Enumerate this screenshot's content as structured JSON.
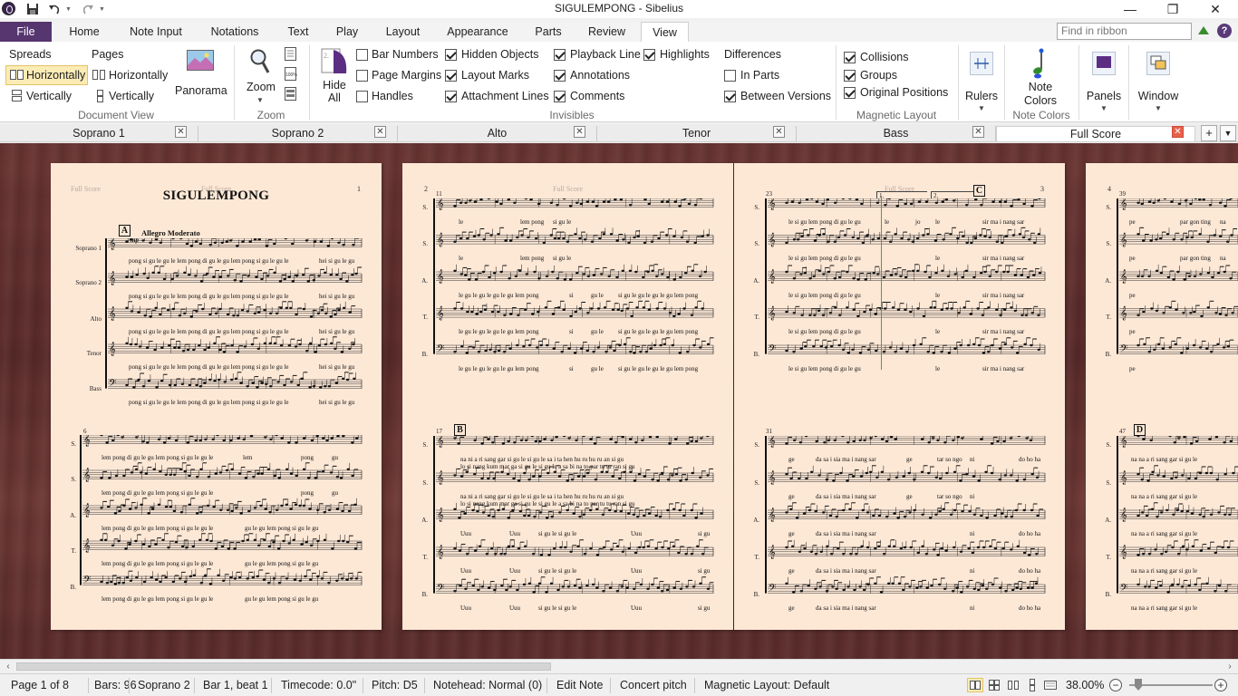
{
  "window": {
    "title": "SIGULEMPONG - Sibelius",
    "minimize_glyph": "—",
    "maximize_glyph": "❐",
    "close_glyph": "✕"
  },
  "quick_access": {
    "save": "save-icon",
    "undo": "undo-icon",
    "redo": "redo-icon"
  },
  "ribbon_tabs": [
    "File",
    "Home",
    "Note Input",
    "Notations",
    "Text",
    "Play",
    "Layout",
    "Appearance",
    "Parts",
    "Review",
    "View"
  ],
  "active_tab": "View",
  "ribbon_search": {
    "placeholder": "Find in ribbon"
  },
  "ribbon": {
    "document_view": {
      "label": "Document View",
      "spreads_label": "Spreads",
      "pages_label": "Pages",
      "spreads_horizontal": "Horizontally",
      "spreads_vertical": "Vertically",
      "pages_horizontal": "Horizontally",
      "pages_vertical": "Vertically",
      "panorama": "Panorama"
    },
    "zoom": {
      "label": "Zoom",
      "zoom_button": "Zoom"
    },
    "invisibles": {
      "label": "Invisibles",
      "hide_all": "Hide All",
      "items": [
        {
          "label": "Bar Numbers",
          "checked": false
        },
        {
          "label": "Page Margins",
          "checked": false
        },
        {
          "label": "Handles",
          "checked": false
        },
        {
          "label": "Hidden Objects",
          "checked": true
        },
        {
          "label": "Layout Marks",
          "checked": true
        },
        {
          "label": "Attachment Lines",
          "checked": true
        },
        {
          "label": "Playback Line",
          "checked": true
        },
        {
          "label": "Annotations",
          "checked": true
        },
        {
          "label": "Comments",
          "checked": true
        },
        {
          "label": "Highlights",
          "checked": true
        }
      ],
      "differences_label": "Differences",
      "differences": [
        {
          "label": "In Parts",
          "checked": false
        },
        {
          "label": "Between Versions",
          "checked": true
        }
      ]
    },
    "magnetic_layout": {
      "label": "Magnetic Layout",
      "items": [
        {
          "label": "Collisions",
          "checked": true
        },
        {
          "label": "Groups",
          "checked": true
        },
        {
          "label": "Original Positions",
          "checked": true
        }
      ]
    },
    "rulers": "Rulers",
    "note_colors": {
      "button": "Note Colors",
      "label": "Note Colors"
    },
    "panels": "Panels",
    "window_btn": "Window"
  },
  "score_tabs": [
    {
      "label": "Soprano 1",
      "active": false
    },
    {
      "label": "Soprano 2",
      "active": false
    },
    {
      "label": "Alto",
      "active": false
    },
    {
      "label": "Tenor",
      "active": false
    },
    {
      "label": "Bass",
      "active": false
    },
    {
      "label": "Full Score",
      "active": true
    }
  ],
  "score": {
    "title": "SIGULEMPONG",
    "header": "Full Score",
    "tempo": "Allegro Moderato",
    "mp": "mp",
    "instruments": [
      "Soprano 1",
      "Soprano 2",
      "Alto",
      "Tenor",
      "Bass"
    ],
    "abbrev": [
      "S.",
      "S.",
      "A.",
      "T.",
      "B."
    ],
    "page_numbers": [
      "1",
      "2",
      "3",
      "4"
    ],
    "rehearsal_marks": [
      "A",
      "B",
      "C",
      "D"
    ],
    "bar_numbers": [
      "6",
      "11",
      "17",
      "23",
      "31",
      "39",
      "47"
    ],
    "endings": [
      "1.",
      "2."
    ],
    "lyrics": {
      "p1s1_sop": "pong si gu le gu le lem pong di gu le gu lem pong si gu le gu le",
      "p1s1_hei": "hei si gu le gu",
      "p1s1_alto": "pong si gu le gu le lem pong di gu le gu lem pong si gu le gu le",
      "p1s2_a": "lem pong di gu le gu lem pong si gu le gu le",
      "p1s2_b": "lem",
      "p1s2_c": "pong",
      "p1s2_d": "gu",
      "p1s2_alto": "lem pong di gu le gu lem pong si gu le gu le",
      "p1s2_alto2": "gu le gu lem pong si gu le gu",
      "p2s1_le": "le",
      "p2s1_lem": "lem pong",
      "p2s1_si": "si gu le",
      "p2s1_alto": "le gu le gu le gu le gu lem pong",
      "p2s1_alto2": "si",
      "p2s1_alto3": "gu le",
      "p2s1_alto4": "si gu le gu le gu le gu lem pong",
      "p2s2_s1": "na ni a ri sang gar si gu le si gu le sa i ta hen hu ru hu ru an si gu",
      "p2s2_s2": "lo si nang kum mar ga si gu le si gu le a sa bi na to par tu tu ran si gu",
      "p2s2_alto": "Uuu",
      "p2s2_alto2": "si gu le si gu le",
      "p2s2_alto3": "Uuu",
      "p2s2_alto4": "si gu",
      "p3s1_a": "le si gu lem pong di gu le gu",
      "p3s1_b": "le",
      "p3s1_c": "jo",
      "p3s1_d": "le",
      "p3s1_e": "sir ma i nang sar",
      "p3s2_a": "ge",
      "p3s2_b": "da sa i sia ma i nang sar",
      "p3s2_c": "ge",
      "p3s2_d": "tar so ngo",
      "p3s2_e": "ni",
      "p3s2_f": "do ho ha",
      "p4s1_a": "pe",
      "p4s1_b": "par gon ting",
      "p4s1_c": "na",
      "p4s2_a": "na na a ri sang gar si gu le"
    }
  },
  "status": {
    "page": "Page 1 of 8",
    "bars": "Bars: 96",
    "instrument": "Soprano 2",
    "position": "Bar 1, beat 1",
    "timecode": "Timecode: 0.0\"",
    "pitch": "Pitch: D5",
    "notehead": "Notehead: Normal (0)",
    "mode": "Edit Note",
    "concert": "Concert pitch",
    "magnetic": "Magnetic Layout: Default",
    "zoom": "38.00%",
    "zoom_minus": "−",
    "zoom_plus": "+"
  },
  "scroll": {
    "left_arrow": "‹",
    "right_arrow": "›"
  },
  "colors": {
    "file_tab": "#57356f",
    "accent": "#3a8c2e",
    "page": "#fde8d6",
    "wood": "#5f2f2d"
  }
}
